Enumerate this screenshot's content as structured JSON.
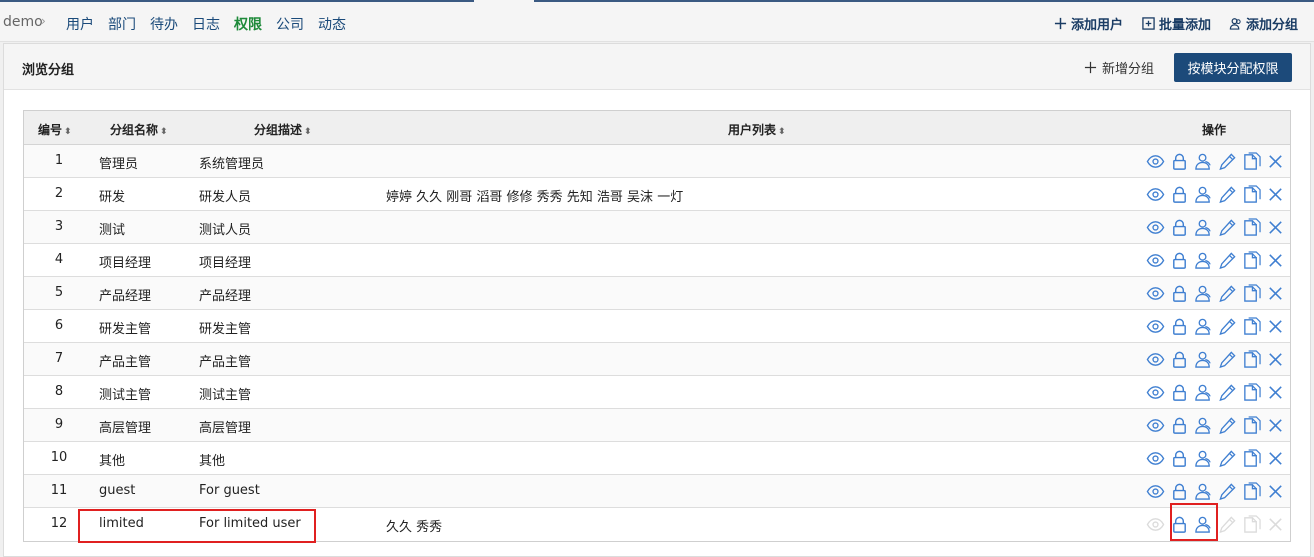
{
  "nav": {
    "root": "demo",
    "sep": "›",
    "items": [
      "用户",
      "部门",
      "待办",
      "日志",
      "权限",
      "公司",
      "动态"
    ],
    "active_index": 4,
    "actions": {
      "add_user": "添加用户",
      "batch_add": "批量添加",
      "add_group": "添加分组"
    }
  },
  "panel": {
    "title": "浏览分组",
    "new_group": "新增分组",
    "assign_by_module": "按模块分配权限"
  },
  "table": {
    "headers": {
      "id": "编号",
      "name": "分组名称",
      "desc": "分组描述",
      "users": "用户列表",
      "actions": "操作"
    },
    "rows": [
      {
        "id": "1",
        "name": "管理员",
        "desc": "系统管理员",
        "users": ""
      },
      {
        "id": "2",
        "name": "研发",
        "desc": "研发人员",
        "users": "婷婷 久久 刚哥 滔哥 修修 秀秀 先知 浩哥 吴沫 一灯"
      },
      {
        "id": "3",
        "name": "测试",
        "desc": "测试人员",
        "users": ""
      },
      {
        "id": "4",
        "name": "项目经理",
        "desc": "项目经理",
        "users": ""
      },
      {
        "id": "5",
        "name": "产品经理",
        "desc": "产品经理",
        "users": ""
      },
      {
        "id": "6",
        "name": "研发主管",
        "desc": "研发主管",
        "users": ""
      },
      {
        "id": "7",
        "name": "产品主管",
        "desc": "产品主管",
        "users": ""
      },
      {
        "id": "8",
        "name": "测试主管",
        "desc": "测试主管",
        "users": ""
      },
      {
        "id": "9",
        "name": "高层管理",
        "desc": "高层管理",
        "users": ""
      },
      {
        "id": "10",
        "name": "其他",
        "desc": "其他",
        "users": ""
      },
      {
        "id": "11",
        "name": "guest",
        "desc": "For guest",
        "users": ""
      },
      {
        "id": "12",
        "name": "limited",
        "desc": "For limited user",
        "users": "久久 秀秀",
        "limited": true
      }
    ],
    "action_icons": [
      "view-icon",
      "lock-icon",
      "manage-members-icon",
      "edit-icon",
      "copy-icon",
      "delete-icon"
    ]
  },
  "colors": {
    "accent": "#1c4a7a",
    "icon": "#3f7fd1",
    "active_nav": "#1e8a3a",
    "highlight": "#e02020"
  }
}
